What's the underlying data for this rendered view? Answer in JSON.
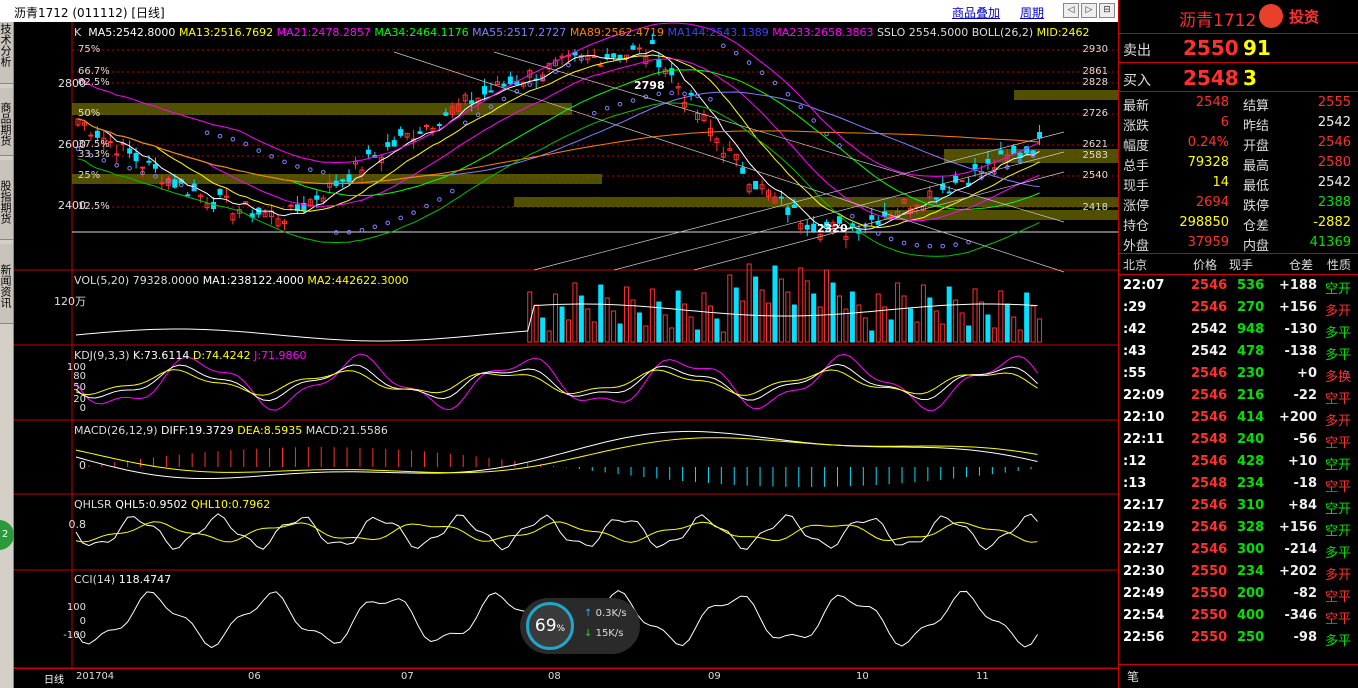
{
  "titlebar": {
    "title": "沥青1712 (011112) [日线]",
    "overlay_link": "商品叠加",
    "period_link": "周期",
    "nav_buttons": [
      "◁",
      "▷",
      "⊟",
      "⊞"
    ]
  },
  "left_tabs": [
    "技术分析",
    "商品期货",
    "股指期货",
    "新闻资讯"
  ],
  "left_badge": "2",
  "main_indicators": {
    "k": "K",
    "ma5": "MA5:2542.8000",
    "ma13": "MA13:2516.7692",
    "ma21": "MA21:2478.2857",
    "ma34": "MA34:2464.1176",
    "ma55": "MA55:2517.2727",
    "ma89": "MA89:2562.4719",
    "ma144": "MA144:2543.1389",
    "ma233": "MA233:2658.3863",
    "sslo": "SSLO  2554.5000",
    "boll": "BOLL(26,2)",
    "mid": "MID:2462"
  },
  "price_axis": [
    "2800",
    "2600",
    "2400"
  ],
  "fib_levels": [
    "75%",
    "66.7%",
    "62.5%",
    "50%",
    "37.5%",
    "33.3%",
    "25%",
    "12.5%"
  ],
  "price_marks": [
    "2930",
    "2861",
    "2828",
    "2726",
    "2621",
    "2583",
    "2540",
    "2418"
  ],
  "annotations": {
    "high": "2798",
    "low": "2320"
  },
  "vol_pane": {
    "label": "VOL(5,20) 79328.0000",
    "ma1": "MA1:238122.4000",
    "ma2": "MA2:442622.3000",
    "axis": "120万"
  },
  "kdj_pane": {
    "label": "KDJ(9,3,3)",
    "k": "K:73.6114",
    "d": "D:74.4242",
    "j": "J:71.9860",
    "axis": [
      "100",
      "80",
      "50",
      "20",
      "0"
    ]
  },
  "macd_pane": {
    "label": "MACD(26,12,9)",
    "diff": "DIFF:19.3729",
    "dea": "DEA:8.5935",
    "macd": "MACD:21.5586",
    "axis": "0"
  },
  "qhlsr_pane": {
    "label": "QHLSR",
    "qhl5": "QHL5:0.9502",
    "qhl10": "QHL10:0.7962",
    "axis": "0.8"
  },
  "cci_pane": {
    "label": "CCI(14)",
    "value": "118.4747",
    "axis": [
      "100",
      "0",
      "-100"
    ]
  },
  "bottom_axis": {
    "period": "日线",
    "months": [
      "201704",
      "06",
      "07",
      "08",
      "09",
      "10",
      "11"
    ]
  },
  "speed": {
    "percent": "69",
    "unit": "%",
    "up": "0.3K/s",
    "down": "15K/s"
  },
  "quote": {
    "name": "沥青1712",
    "brand": "投资",
    "sell_label": "卖出",
    "sell_price": "2550",
    "sell_vol": "91",
    "buy_label": "买入",
    "buy_price": "2548",
    "buy_vol": "3",
    "rows": [
      {
        "l1": "最新",
        "v1": "2548",
        "c1": "red",
        "l2": "结算",
        "v2": "2555",
        "c2": "red"
      },
      {
        "l1": "涨跌",
        "v1": "6",
        "c1": "red",
        "l2": "昨结",
        "v2": "2542",
        "c2": "white"
      },
      {
        "l1": "幅度",
        "v1": "0.24%",
        "c1": "red",
        "l2": "开盘",
        "v2": "2546",
        "c2": "red"
      },
      {
        "l1": "总手",
        "v1": "79328",
        "c1": "yellow",
        "l2": "最高",
        "v2": "2580",
        "c2": "red"
      },
      {
        "l1": "现手",
        "v1": "14",
        "c1": "yellow",
        "l2": "最低",
        "v2": "2542",
        "c2": "white"
      },
      {
        "l1": "涨停",
        "v1": "2694",
        "c1": "red",
        "l2": "跌停",
        "v2": "2388",
        "c2": "green"
      },
      {
        "l1": "持仓",
        "v1": "298850",
        "c1": "yellow",
        "l2": "仓差",
        "v2": "-2882",
        "c2": "yellow"
      },
      {
        "l1": "外盘",
        "v1": "37959",
        "c1": "red",
        "l2": "内盘",
        "v2": "41369",
        "c2": "green"
      }
    ],
    "tick_header": [
      "北京",
      "价格",
      "现手",
      "仓差",
      "性质"
    ],
    "ticks": [
      {
        "t": "22:07",
        "p": "2546",
        "v": "536",
        "d": "+188",
        "n": "空开",
        "nc": "green"
      },
      {
        "t": ":29",
        "p": "2546",
        "v": "270",
        "d": "+156",
        "n": "多开",
        "nc": "red"
      },
      {
        "t": ":42",
        "p": "2542",
        "v": "948",
        "d": "-130",
        "n": "多平",
        "nc": "green"
      },
      {
        "t": ":43",
        "p": "2542",
        "v": "478",
        "d": "-138",
        "n": "多平",
        "nc": "green"
      },
      {
        "t": ":55",
        "p": "2546",
        "v": "230",
        "d": "+0",
        "n": "多换",
        "nc": "red"
      },
      {
        "t": "22:09",
        "p": "2546",
        "v": "216",
        "d": "-22",
        "n": "空平",
        "nc": "red"
      },
      {
        "t": "22:10",
        "p": "2546",
        "v": "414",
        "d": "+200",
        "n": "多开",
        "nc": "red"
      },
      {
        "t": "22:11",
        "p": "2548",
        "v": "240",
        "d": "-56",
        "n": "空平",
        "nc": "red"
      },
      {
        "t": ":12",
        "p": "2546",
        "v": "428",
        "d": "+10",
        "n": "空开",
        "nc": "green"
      },
      {
        "t": ":13",
        "p": "2548",
        "v": "234",
        "d": "-18",
        "n": "空平",
        "nc": "red"
      },
      {
        "t": "22:17",
        "p": "2546",
        "v": "310",
        "d": "+84",
        "n": "空开",
        "nc": "green"
      },
      {
        "t": "22:19",
        "p": "2546",
        "v": "328",
        "d": "+156",
        "n": "空开",
        "nc": "green"
      },
      {
        "t": "22:27",
        "p": "2546",
        "v": "300",
        "d": "-214",
        "n": "多平",
        "nc": "green"
      },
      {
        "t": "22:30",
        "p": "2550",
        "v": "234",
        "d": "+202",
        "n": "多开",
        "nc": "red"
      },
      {
        "t": "22:49",
        "p": "2550",
        "v": "200",
        "d": "-82",
        "n": "空平",
        "nc": "red"
      },
      {
        "t": "22:54",
        "p": "2550",
        "v": "400",
        "d": "-346",
        "n": "空平",
        "nc": "red"
      },
      {
        "t": "22:56",
        "p": "2550",
        "v": "250",
        "d": "-98",
        "n": "多平",
        "nc": "green"
      }
    ],
    "footer": "笔"
  },
  "colors": {
    "up": "#ff3030",
    "down": "#00e0ff",
    "grid": "#c00000",
    "ma5": "#ffffff",
    "ma13": "#ffff00",
    "ma21": "#ff00ff",
    "ma34": "#00ff00",
    "ma55": "#8080ff",
    "ma89": "#ff8000",
    "ma144": "#0000ff",
    "ma233": "#ff00ff"
  }
}
